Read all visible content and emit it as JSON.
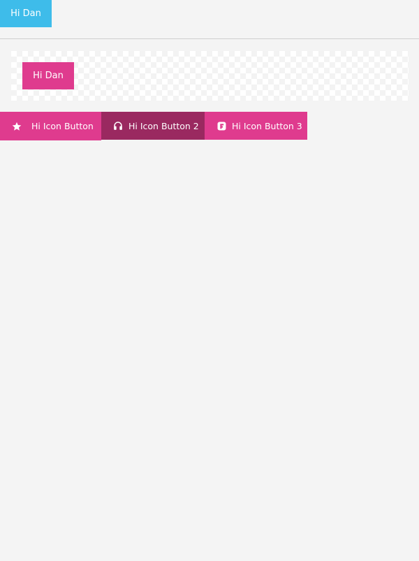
{
  "top_bar": {
    "button_label": "Hi Dan"
  },
  "preview": {
    "button_label": "Hi Dan"
  },
  "icon_buttons": [
    {
      "label": "Hi Icon Button",
      "icon": "star-icon"
    },
    {
      "label": "Hi Icon Button 2",
      "icon": "headphones-icon"
    },
    {
      "label": "Hi Icon Button 3",
      "icon": "app-icon"
    }
  ],
  "colors": {
    "blue": "#3ebcea",
    "pink": "#df3b8e",
    "pink_dark": "#9a2960",
    "background": "#f4f4f4"
  }
}
